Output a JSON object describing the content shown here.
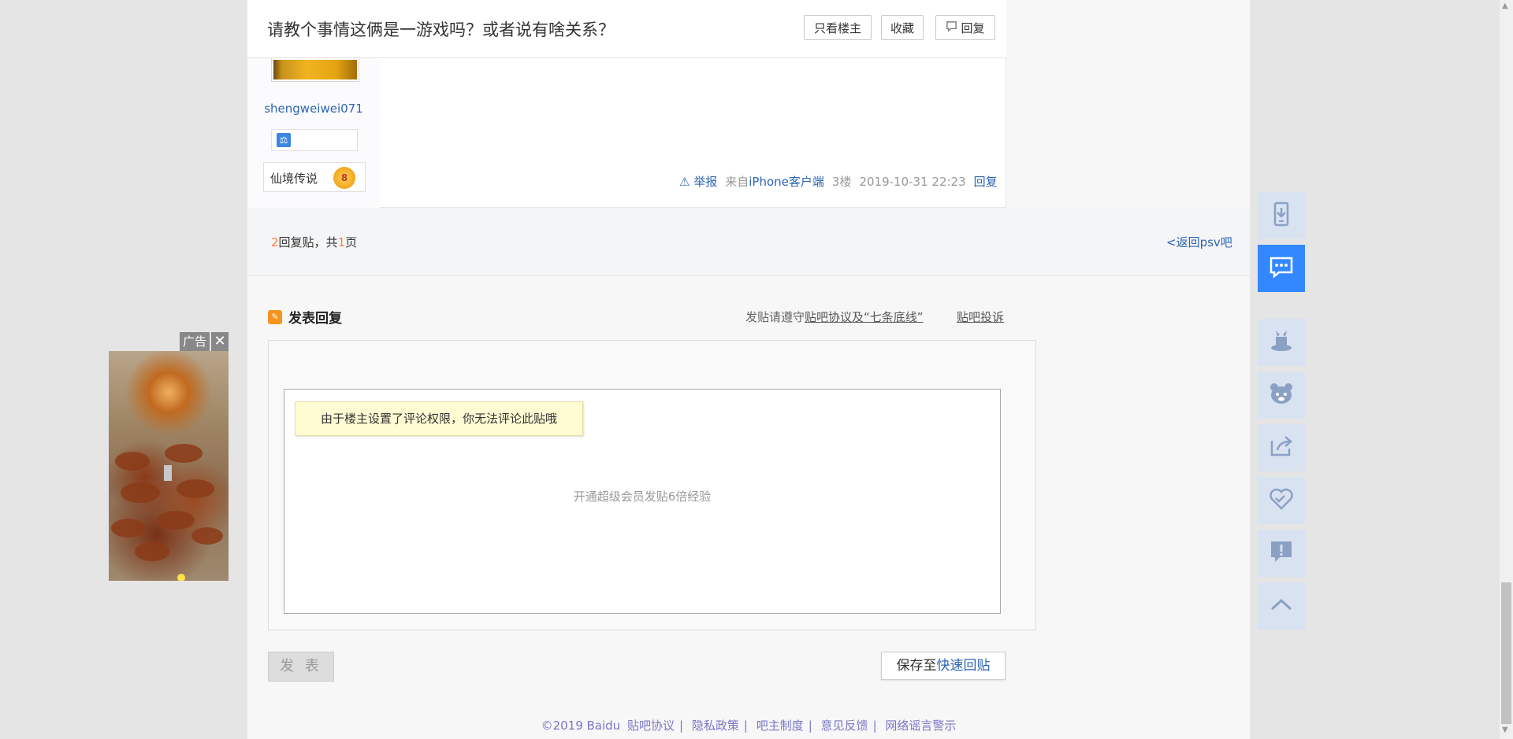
{
  "thread": {
    "title": "请教个事情这俩是一游戏吗？或者说有啥关系？",
    "buttons": {
      "only_op": "只看楼主",
      "favorite": "收藏",
      "reply": "回复"
    }
  },
  "author": {
    "username": "shengweiwei071",
    "level_name": "仙境传说",
    "level_num": "8"
  },
  "post_meta": {
    "report": "举报",
    "source_prefix": "来自",
    "source": "iPhone客户端",
    "floor": "3楼",
    "time": "2019-10-31 22:23",
    "reply": "回复"
  },
  "pagination": {
    "reply_count": "2",
    "text_mid": "回复贴，共",
    "page_count": "1",
    "text_end": "页",
    "back_link": "<返回psv吧"
  },
  "editor": {
    "title": "发表回复",
    "rules_prefix": "发贴请遵守",
    "rules_link": "贴吧协议及“七条底线”",
    "complaint": "贴吧投诉",
    "permission_tip": "由于楼主设置了评论权限，你无法评论此贴哦",
    "vip_tip": "开通超级会员发贴6倍经验",
    "submit": "发 表",
    "save_prefix": "保存至",
    "save_link": "快速回贴"
  },
  "footer": {
    "copyright": "©2019 Baidu",
    "links": [
      "贴吧协议",
      "隐私政策",
      "吧主制度",
      "意见反馈",
      "网络谣言警示"
    ]
  },
  "ad": {
    "label": "广告",
    "close": "✕"
  },
  "sidebar": {
    "items": [
      {
        "icon": "phone-download-icon",
        "active": false
      },
      {
        "icon": "chat-bubble-icon",
        "active": true
      },
      {
        "icon": "magic-hat-icon",
        "active": false
      },
      {
        "icon": "bear-face-icon",
        "active": false
      },
      {
        "icon": "share-icon",
        "active": false
      },
      {
        "icon": "heart-icon",
        "active": false
      },
      {
        "icon": "report-icon",
        "active": false
      },
      {
        "icon": "back-to-top-icon",
        "active": false
      }
    ]
  },
  "colors": {
    "accent": "#3388ff",
    "link": "#2d64b3",
    "count": "#ff7f3e",
    "sidebar_bg": "#d9e2f1",
    "icon": "#8aa1c4"
  }
}
